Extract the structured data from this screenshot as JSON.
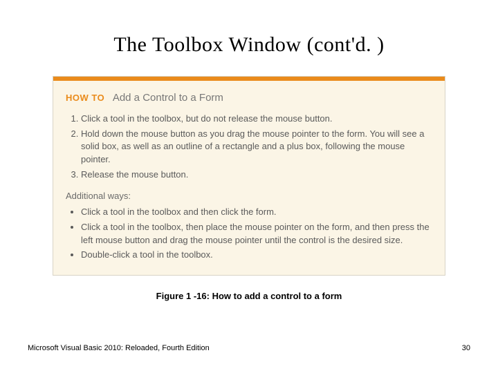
{
  "title": "The Toolbox Window (cont'd. )",
  "howto": {
    "label": "HOW TO",
    "subtitle": "Add a Control to a Form",
    "steps": [
      "Click a tool in the toolbox, but do not release the mouse button.",
      "Hold down the mouse button as you drag the mouse pointer to the form. You will see a solid box, as well as an outline of a rectangle and a plus box, following the mouse pointer.",
      "Release the mouse button."
    ],
    "additional_label": "Additional ways:",
    "additional": [
      "Click a tool in the toolbox and then click the form.",
      "Click a tool in the toolbox, then place the mouse pointer on the form, and then press the left mouse button and drag the mouse pointer until the control is the desired size.",
      "Double-click a tool in the toolbox."
    ]
  },
  "caption": "Figure 1 -16: How to add a control to a form",
  "footer": {
    "text": "Microsoft Visual Basic 2010: Reloaded, Fourth Edition",
    "page": "30"
  }
}
